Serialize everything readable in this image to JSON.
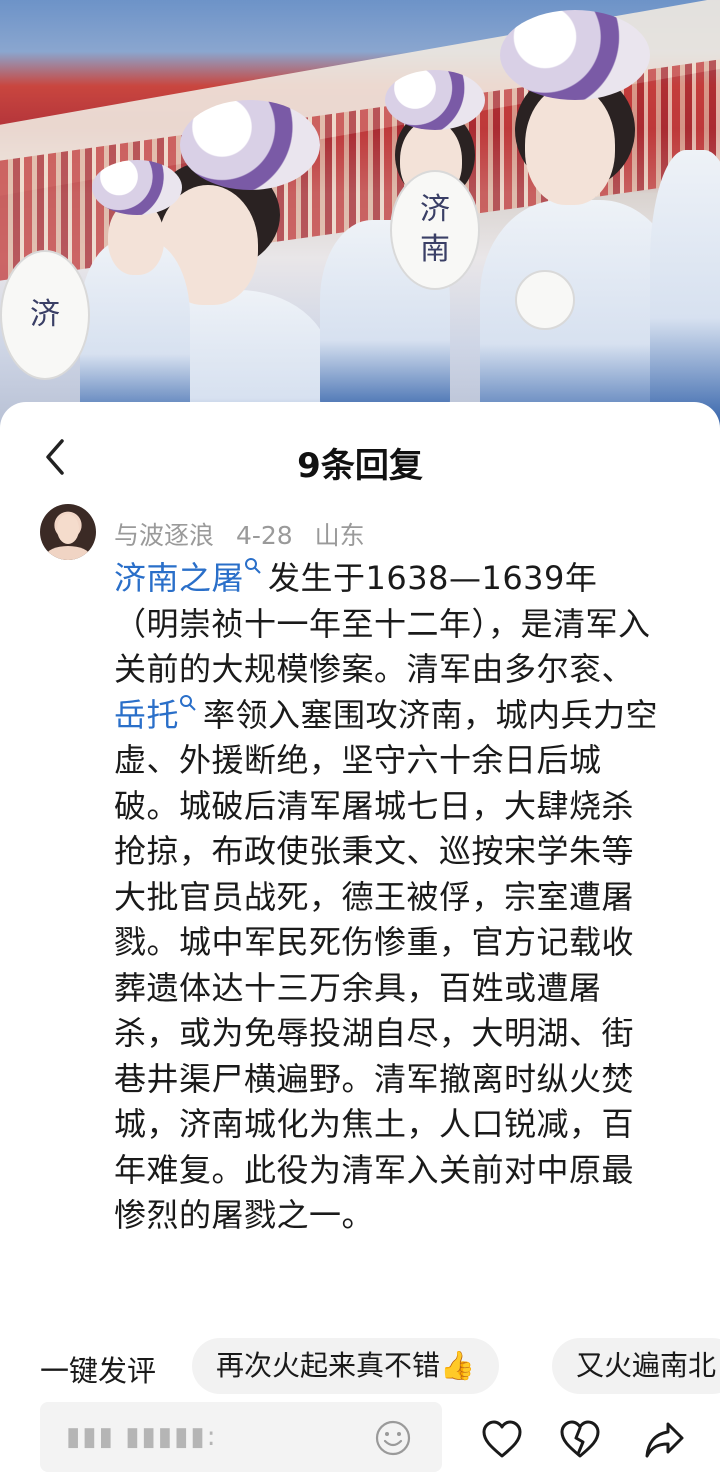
{
  "video": {
    "fan_text": [
      "济",
      "南"
    ],
    "fan_text_left": "济"
  },
  "sheet": {
    "title": "9条回复",
    "back_icon": "chevron-left-icon"
  },
  "comment": {
    "username": "与波逐浪",
    "date": "4-28",
    "location": "山东",
    "link1": "济南之屠",
    "part1": "发生于1638—1639年（明崇祯十一年至十二年），是清军入关前的大规模惨案。清军由多尔衮、",
    "link2": "岳托",
    "part2": "率领入塞围攻济南，城内兵力空虚、外援断绝，坚守六十余日后城破。城破后清军屠城七日，大肆烧杀抢掠，布政使张秉文、巡按宋学朱等大批官员战死，德王被俘，宗室遭屠戮。城中军民死伤惨重，官方记载收葬遗体达十三万余具，百姓或遭屠杀，或为免辱投湖自尽，大明湖、街巷井渠尸横遍野。清军撤离时纵火焚城，济南城化为焦土，人口锐减，百年难复。此役为清军入关前对中原最惨烈的屠戮之一。",
    "link_icon": "search-icon"
  },
  "quick_reply": {
    "label": "一键发评",
    "chips": [
      "再次火起来真不错👍",
      "又火遍南北"
    ]
  },
  "input": {
    "placeholder": "▮▮▮ ▮▮▮▮▮:"
  },
  "actions": {
    "emoji_icon": "smile-icon",
    "like_icon": "heart-icon",
    "dislike_icon": "broken-heart-icon",
    "share_icon": "share-icon"
  }
}
